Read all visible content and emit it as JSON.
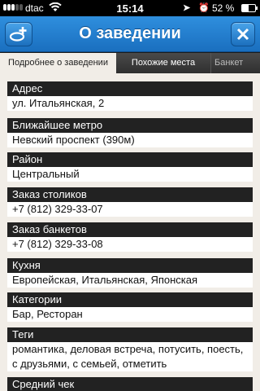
{
  "status": {
    "carrier": "dtac",
    "time": "15:14",
    "battery": "52 %"
  },
  "nav": {
    "title": "О заведении"
  },
  "tabs": [
    {
      "label": "Подробнее о заведении"
    },
    {
      "label": "Похожие места"
    },
    {
      "label": "Банкет"
    }
  ],
  "sections": [
    {
      "header": "Адрес",
      "value": "ул. Итальянская, 2"
    },
    {
      "header": "Ближайшее метро",
      "value": "Невский проспект (390м)"
    },
    {
      "header": "Район",
      "value": "Центральный"
    },
    {
      "header": "Заказ столиков",
      "value": "+7 (812) 329-33-07"
    },
    {
      "header": "Заказ банкетов",
      "value": "+7 (812) 329-33-08"
    },
    {
      "header": "Кухня",
      "value": "Европейская, Итальянская, Японская"
    },
    {
      "header": "Категории",
      "value": "Бар, Ресторан"
    },
    {
      "header": "Теги",
      "value": "романтика, деловая встреча, потусить, поесть, с друзьями, с семьей, отметить"
    },
    {
      "header": "Средний чек",
      "value": ""
    }
  ]
}
